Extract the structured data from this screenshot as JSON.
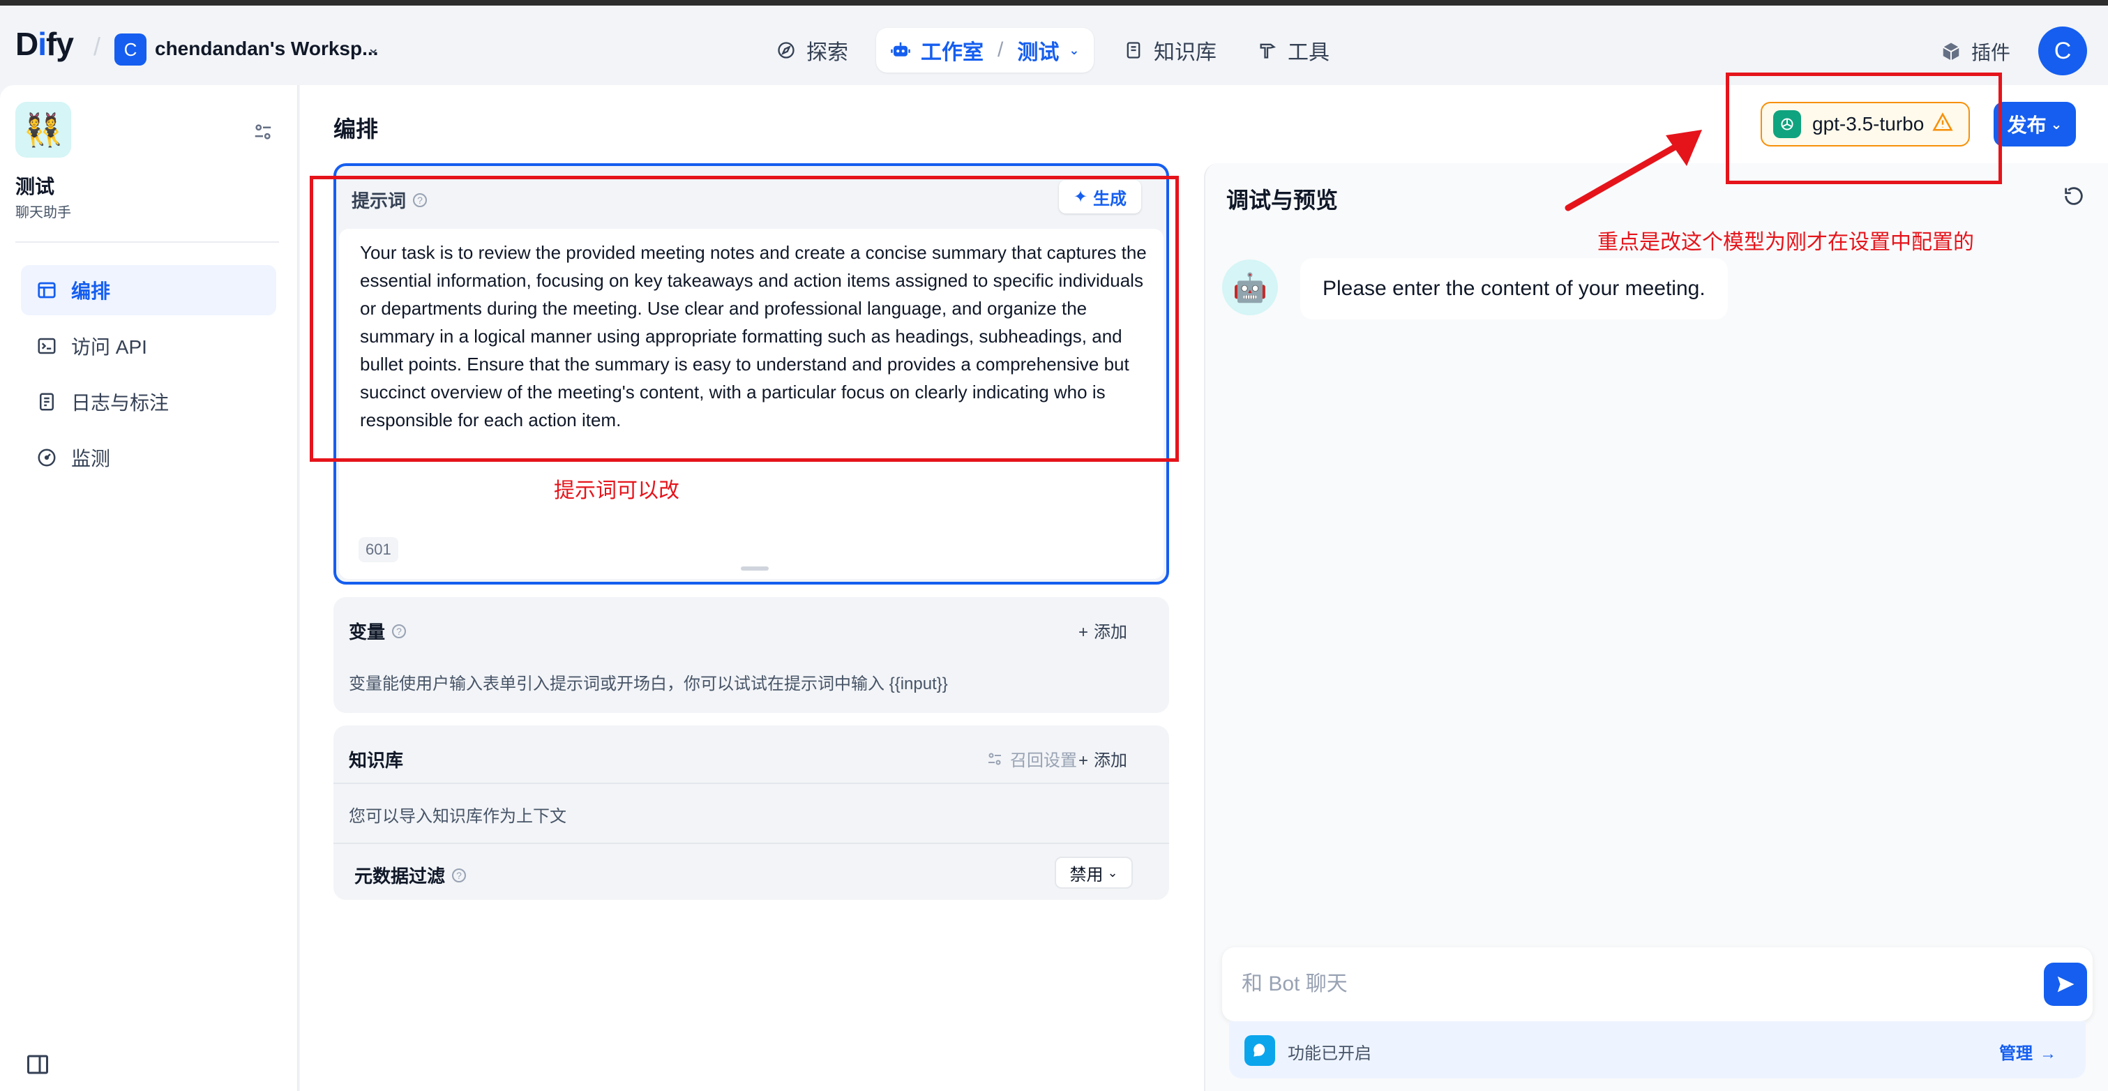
{
  "topnav": {
    "logo_prefix": "D",
    "logo_i": "i",
    "logo_suffix": "fy",
    "workspace_initial": "C",
    "workspace_name": "chendandan's Worksp...",
    "explore": "探索",
    "studio": "工作室",
    "current_app": "测试",
    "knowledge": "知识库",
    "tools": "工具",
    "plugins": "插件",
    "user_initial": "C"
  },
  "sidebar": {
    "app_name": "测试",
    "app_type": "聊天助手",
    "items": [
      {
        "label": "编排"
      },
      {
        "label": "访问 API"
      },
      {
        "label": "日志与标注"
      },
      {
        "label": "监测"
      }
    ]
  },
  "main": {
    "title": "编排",
    "model": "gpt-3.5-turbo",
    "publish": "发布"
  },
  "prompt": {
    "title": "提示词",
    "generate": "生成",
    "text": "Your task is to review the provided meeting notes and create a concise summary that captures the essential information, focusing on key takeaways and action items assigned to specific individuals or departments during the meeting. Use clear and professional language, and organize the summary in a logical manner using appropriate formatting such as headings, subheadings, and bullet points. Ensure that the summary is easy to understand and provides a comprehensive but succinct overview of the meeting's content, with a particular focus on clearly indicating who is responsible for each action item.",
    "char_count": "601"
  },
  "variables": {
    "title": "变量",
    "add": "添加",
    "desc": "变量能使用户输入表单引入提示词或开场白，你可以试试在提示词中输入 {{input}}"
  },
  "knowledge": {
    "title": "知识库",
    "recall": "召回设置",
    "add": "添加",
    "desc": "您可以导入知识库作为上下文",
    "metadata_filter": "元数据过滤",
    "filter_value": "禁用"
  },
  "debug": {
    "title": "调试与预览",
    "bot_message": "Please enter the content of your meeting.",
    "input_placeholder": "和 Bot 聊天",
    "feature_text": "功能已开启",
    "manage": "管理"
  },
  "annotations": {
    "model_note": "重点是改这个模型为刚才在设置中配置的",
    "prompt_note": "提示词可以改"
  },
  "colors": {
    "accent": "#155eef",
    "warning": "#f79009",
    "annotation": "#e5141b"
  }
}
